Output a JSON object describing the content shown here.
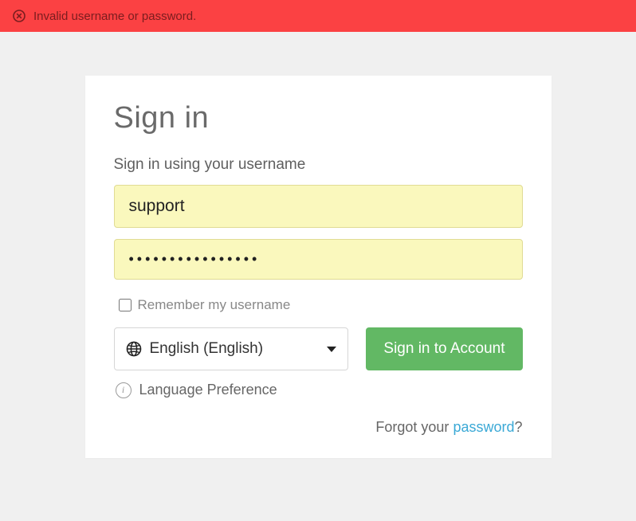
{
  "error": {
    "message": "Invalid username or password."
  },
  "card": {
    "title": "Sign in",
    "subtitle": "Sign in using your username",
    "username_value": "support",
    "password_value": "••••••••••••••••",
    "remember_label": "Remember my username",
    "language_selected": "English (English)",
    "signin_button": "Sign in to Account",
    "language_pref_label": "Language Preference",
    "forgot_prefix": "Forgot your ",
    "forgot_link": "password",
    "forgot_suffix": "?"
  }
}
